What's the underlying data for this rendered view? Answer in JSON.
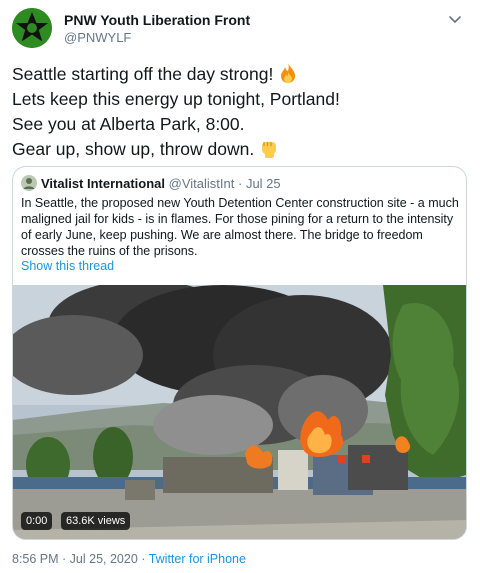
{
  "author": {
    "display_name": "PNW Youth Liberation Front",
    "handle": "@PNWYLF",
    "avatar_icon": "star-logo-avatar"
  },
  "tweet": {
    "lines": [
      "Seattle starting off the day strong!",
      "Lets keep this energy up tonight, Portland!",
      "See you at Alberta Park, 8:00.",
      "Gear up, show up, throw down."
    ],
    "emoji": [
      "fire-emoji",
      "raised-fist-emoji"
    ]
  },
  "quoted": {
    "display_name": "Vitalist International",
    "handle": "@VitalistInt",
    "separator": "·",
    "date": "Jul 25",
    "text": "In Seattle, the proposed new Youth Detention Center construction site - a much maligned jail for kids - is in flames. For those pining for a return to the intensity of early June, keep pushing. We are almost there. The bridge to freedom crosses the ruins of the prisons.",
    "thread_link": "Show this thread",
    "video": {
      "time": "0:00",
      "views": "63.6K views"
    }
  },
  "meta": {
    "timestamp": "8:56 PM · Jul 25, 2020",
    "separator": "·",
    "source": "Twitter for iPhone"
  },
  "colors": {
    "link": "#1b95e0",
    "muted": "#657786",
    "text": "#14171a",
    "border": "#ccd6dd"
  }
}
